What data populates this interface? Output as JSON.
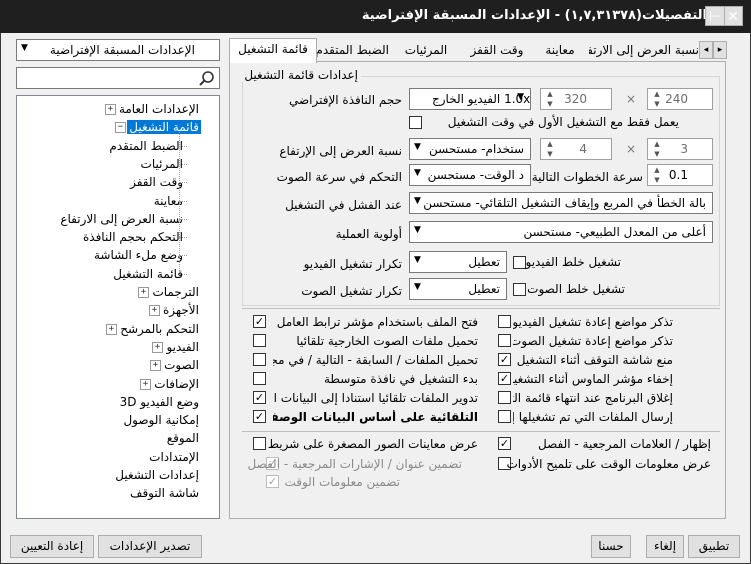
{
  "window": {
    "title": "التفصيلات(١,٧,٣١٣٧٨) - الإعدادات المسبقة الإفتراضية",
    "pin_glyph": "⊣",
    "close_glyph": "✕"
  },
  "preset_combo": {
    "value": "الإعدادات المسبقة الإفتراضية"
  },
  "search": {
    "placeholder": ""
  },
  "tree": {
    "items": [
      {
        "label": "الإعدادات العامة",
        "level": 0,
        "expander": "+"
      },
      {
        "label": "قائمة التشغيل",
        "level": 0,
        "expander": "−",
        "selected": true
      },
      {
        "label": "الضبط المتقدم",
        "level": 1
      },
      {
        "label": "المرئيات",
        "level": 1
      },
      {
        "label": "وقت القفز",
        "level": 1
      },
      {
        "label": "معاينة",
        "level": 1
      },
      {
        "label": "نسبة العرض إلى الارتفاع",
        "level": 1
      },
      {
        "label": "التحكم بحجم النافذة",
        "level": 1
      },
      {
        "label": "وضع ملء الشاشة",
        "level": 1
      },
      {
        "label": "قائمة التشغيل",
        "level": 1
      },
      {
        "label": "الترجمات",
        "level": 0,
        "expander": "+"
      },
      {
        "label": "الأجهزة",
        "level": 0,
        "expander": "+"
      },
      {
        "label": "التحكم بالمرشح",
        "level": 0,
        "expander": "+"
      },
      {
        "label": "الفيديو",
        "level": 0,
        "expander": "+"
      },
      {
        "label": "الصوت",
        "level": 0,
        "expander": "+"
      },
      {
        "label": "الإضافات",
        "level": 0,
        "expander": "+"
      },
      {
        "label": "وضع الفيديو 3D",
        "level": 0
      },
      {
        "label": "إمكانية الوصول",
        "level": 0
      },
      {
        "label": "الموقع",
        "level": 0
      },
      {
        "label": "الإمتدادات",
        "level": 0
      },
      {
        "label": "إعدادات التشغيل",
        "level": 0
      },
      {
        "label": "شاشة التوقف",
        "level": 0
      }
    ]
  },
  "tabs": [
    {
      "label": "قائمة التشغيل",
      "active": true
    },
    {
      "label": "الضبط المتقدم"
    },
    {
      "label": "المرئيات"
    },
    {
      "label": "وقت القفز"
    },
    {
      "label": "معاينة"
    },
    {
      "label": "نسبة العرض إلى الارتفاع"
    }
  ],
  "tab_scroll": {
    "left": "◂",
    "right": "▸"
  },
  "group_title": "إعدادات قائمة التشغيل",
  "fields": {
    "window_size_label": "حجم النافذة الإفتراضي",
    "window_size_combo": "1.0x الفيديو الخارج",
    "width_value": "320",
    "height_value": "240",
    "times_glyph": "×",
    "first_only_label": "يعمل فقط مع التشغيل الأول في وقت التشغيل",
    "aspect_label": "نسبة العرض إلى الإرتفاع",
    "aspect_combo": "ستخدام- مستحسن",
    "aspect_x": "4",
    "aspect_y": "3",
    "speed_label": "التحكم في سرعة الصوت",
    "speed_combo": "د الوقت- مستحسن",
    "steps_label": "سرعة الخطوات التالية",
    "steps_value": "0.1",
    "fail_label": "عند الفشل في التشغيل",
    "fail_combo": "بالة الخطأ في المربع وإيقاف التشغيل التلقائي- مستحسن",
    "priority_label": "أولوية العملية",
    "priority_combo": "أعلى من المعدل الطبيعي- مستحسن",
    "shuffle_video_label": "تشغيل خلط الفيديو",
    "repeat_video_label": "تكرار تشغيل الفيديو",
    "repeat_video_combo": "تعطيل",
    "shuffle_audio_label": "تشغيل خلط الصوت",
    "repeat_audio_label": "تكرار تشغيل الصوت",
    "repeat_audio_combo": "تعطيل"
  },
  "checks_right": [
    {
      "label": "تذكر مواضع إعادة تشغيل الفيديو",
      "checked": false
    },
    {
      "label": "تذكر مواضع إعادة تشغيل الصوت",
      "checked": false
    },
    {
      "label": "منع شاشة التوقف أثناء التشغيل",
      "checked": true
    },
    {
      "label": "إخفاء مؤشر الماوس أثناء التشغيل",
      "checked": true
    },
    {
      "label": "إغلاق البرنامج عند انتهاء قائمة التشغيل",
      "checked": false
    },
    {
      "label": "إرسال الملفات التي تم تشغيلها إلى سلة...",
      "checked": false
    }
  ],
  "checks_left": [
    {
      "label": "فتح الملف باستخدام مؤشر ترابط العامل",
      "checked": true
    },
    {
      "label": "تحميل ملفات الصوت الخارجية تلقائيا",
      "checked": false
    },
    {
      "label": "تحميل الملفات / السابقة - التالية / في مجلد...",
      "checked": false
    },
    {
      "label": "بدء التشغيل في نافذة متوسطة",
      "checked": false
    },
    {
      "label": "تدوير الملفات تلقائيا استنادا إلى البيانات الو...",
      "checked": true
    },
    {
      "label": "التلقائية على أساس البيانات الوصفية retitl...",
      "checked": true,
      "bold": true
    }
  ],
  "bottom_checks": {
    "bookmarks_label": "إظهار / العلامات المرجعية - الفصل",
    "bookmarks_checked": true,
    "thumbs_label": "عرض معاينات الصور المصغرة على شريط ا...",
    "thumbs_checked": false,
    "time_info_label": "عرض معلومات الوقت على تلميح الأدوات",
    "time_info_checked": false,
    "include_title_label": "تضمين عنوان / الإشارات المرجعية - الفصل",
    "include_title_checked": true,
    "include_time_label": "تضمين معلومات الوقت",
    "include_time_checked": true
  },
  "buttons": {
    "apply": "تطبيق",
    "cancel": "إلغاء",
    "ok": "حسنا",
    "export": "تصدير الإعدادات",
    "reset": "إعادة التعيين"
  },
  "glyphs": {
    "check": "✓",
    "combo_arrow": "▼",
    "spin_up": "▲",
    "spin_down": "▼"
  }
}
